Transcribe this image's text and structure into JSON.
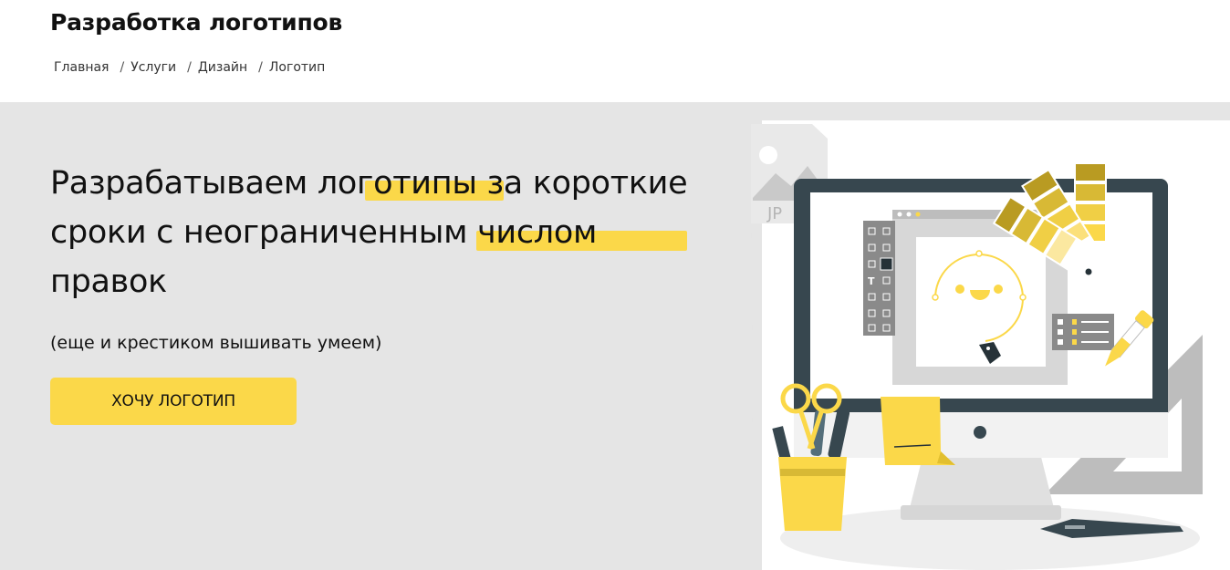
{
  "header": {
    "title": "Разработка логотипов",
    "breadcrumb": [
      "Главная",
      "Услуги",
      "Дизайн",
      "Логотип"
    ],
    "separator": "/"
  },
  "hero": {
    "headline_line1": "Разрабатываем логотипы за короткие",
    "headline_line2": "сроки с неограниченным числом",
    "headline_line3": "правок",
    "subline": "(еще и крестиком вышивать умеем)",
    "cta_label": "ХОЧУ ЛОГОТИП"
  },
  "illustration": {
    "file_tag": "JP",
    "tools_icons": [
      "select-icon",
      "direct-select-icon",
      "magic-wand-icon",
      "lasso-icon",
      "pen-tool-icon",
      "anchor-icon",
      "type-icon",
      "line-icon",
      "rectangle-icon",
      "edit-icon",
      "pencil-icon",
      "scissors-icon",
      "gradient-icon",
      "transform-icon"
    ],
    "type_tool_glyph": "T"
  },
  "colors": {
    "accent": "#fbd849",
    "hero_bg": "#e5e5e5",
    "monitor_frame": "#37474f",
    "text": "#111111"
  }
}
